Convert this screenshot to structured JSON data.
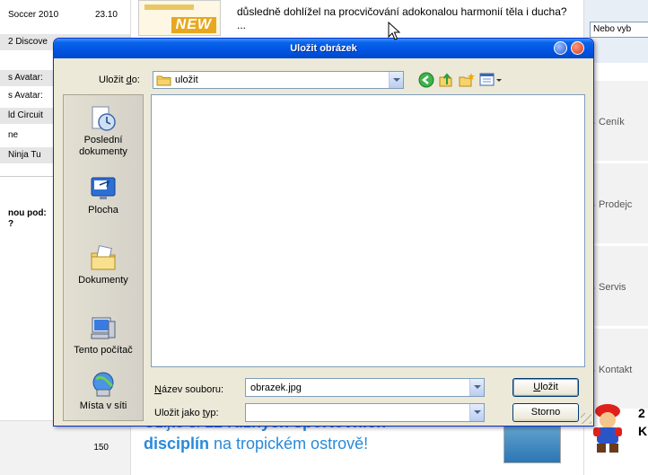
{
  "background": {
    "left_list": [
      {
        "text": "Soccer 2010",
        "num": "23.10",
        "shaded": false
      },
      {
        "text": "2 Discove",
        "num": "",
        "shaded": true
      },
      {
        "text": "s Avatar:",
        "num": "",
        "shaded": true
      },
      {
        "text": "s Avatar:",
        "num": "",
        "shaded": false
      },
      {
        "text": "ld Circuit",
        "num": "",
        "shaded": true
      },
      {
        "text": "ne",
        "num": "",
        "shaded": false
      },
      {
        "text": "Ninja Tu",
        "num": "",
        "shaded": true
      }
    ],
    "left_bold": "nou pod:\n?",
    "left_bottom_num": "150",
    "article_text": "důsledně dohlížel na procvičování adokonalou harmonií těla i ducha? ...",
    "ad_new_badge": "NEW",
    "banner_line1_prefix": "Užijte si ",
    "banner_line1_bold": "12 různých sportovních",
    "banner_line2_bold": "disciplín",
    "banner_line2_suffix": " na tropickém ostrově!",
    "right_select_text": "Nebo vyb",
    "right_menu": [
      "Ceník",
      "Prodejc",
      "Servis",
      "Kontakt"
    ],
    "right_promo": "2\nK"
  },
  "dialog": {
    "title": "Uložit obrázek",
    "save_in_label_pre": "Uložit ",
    "save_in_label_key": "d",
    "save_in_label_post": "o:",
    "save_in_value": "uložit",
    "places": [
      {
        "label": "Poslední dokumenty",
        "icon": "recent-documents-icon"
      },
      {
        "label": "Plocha",
        "icon": "desktop-icon"
      },
      {
        "label": "Dokumenty",
        "icon": "my-documents-icon"
      },
      {
        "label": "Tento počítač",
        "icon": "my-computer-icon"
      },
      {
        "label": "Místa v síti",
        "icon": "network-places-icon"
      }
    ],
    "filename_label_key": "N",
    "filename_label_post": "ázev souboru:",
    "filename_value": "obrazek.jpg",
    "filetype_label_pre": "Uložit jako ",
    "filetype_label_key": "t",
    "filetype_label_post": "yp:",
    "filetype_value": "",
    "save_button_key": "U",
    "save_button_post": "ložit",
    "cancel_button": "Storno"
  },
  "colors": {
    "titlebar": "#0054e3",
    "dialog_bg": "#ece9d8",
    "banner_text": "#2a8ad8"
  }
}
